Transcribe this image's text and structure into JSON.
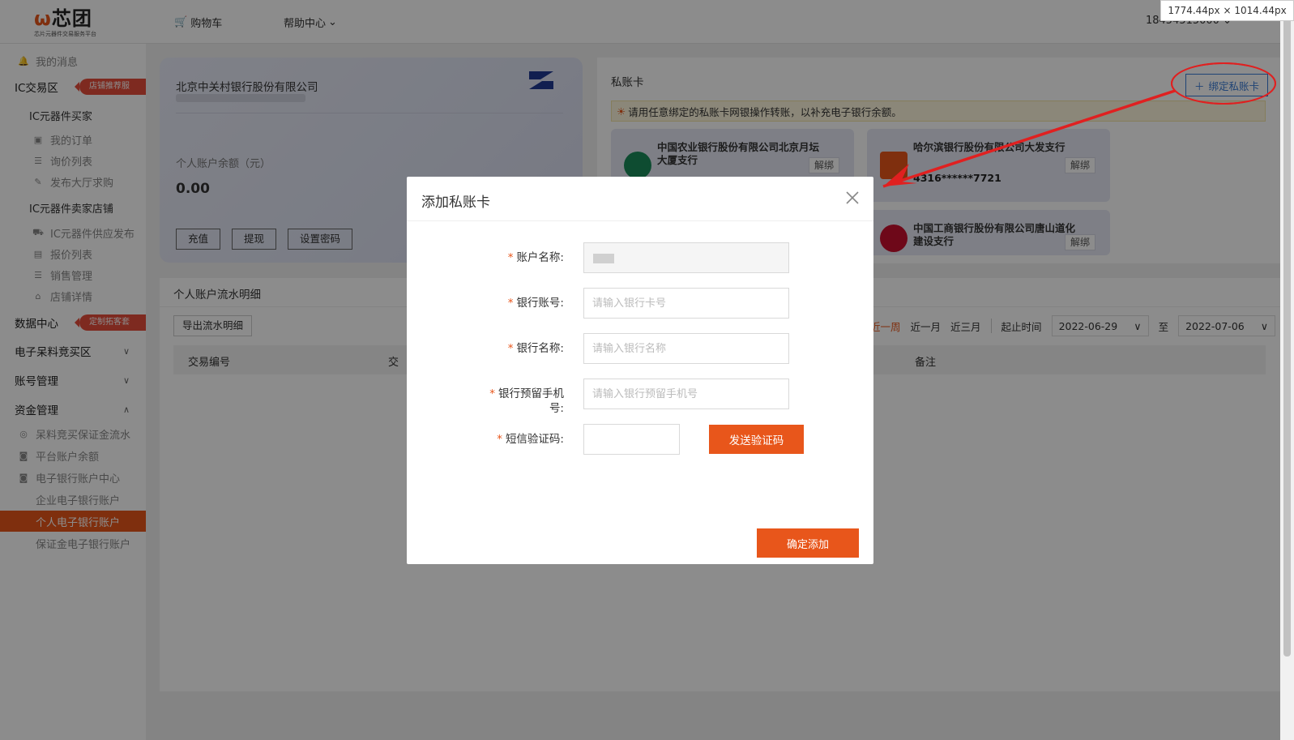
{
  "size_badge": "1774.44px × 1014.44px",
  "header": {
    "logo_text": "芯团",
    "logo_sub": "芯片元器件交易服务平台",
    "cart": "购物车",
    "help": "帮助中心",
    "user": "18454515000"
  },
  "sidebar": {
    "messages": "我的消息",
    "ic_zone": "IC交易区",
    "ic_zone_tag": "店铺推荐服务",
    "buyer": "IC元器件买家",
    "my_orders": "我的订单",
    "inquiry_list": "询价列表",
    "publish_purchase": "发布大厅求购",
    "seller_store": "IC元器件卖家店铺",
    "supply_publish": "IC元器件供应发布",
    "quote_list": "报价列表",
    "sales_mgmt": "销售管理",
    "store_detail": "店铺详情",
    "data_center": "数据中心",
    "data_center_tag": "定制拓客套餐",
    "e_bidding": "电子呆料竞买区",
    "account_mgmt": "账号管理",
    "fund_mgmt": "资金管理",
    "deposit_flow": "呆料竞买保证金流水",
    "platform_balance": "平台账户余额",
    "ebank_center": "电子银行账户中心",
    "corp_ebank": "企业电子银行账户",
    "personal_ebank": "个人电子银行账户",
    "deposit_ebank": "保证金电子银行账户"
  },
  "account_card": {
    "bank": "北京中关村银行股份有限公司",
    "balance_label": "个人账户余额（元）",
    "balance": "0.00",
    "recharge": "充值",
    "withdraw": "提现",
    "set_password": "设置密码"
  },
  "private_cards": {
    "title": "私账卡",
    "bind_button": "绑定私账卡",
    "notice": "请用任意绑定的私账卡网银操作转账，以补充电子银行余额。",
    "cards": [
      {
        "name": "中国农业银行股份有限公司北京月坛大厦支行",
        "number": "",
        "unbind": "解绑",
        "color": "#1a8a5a"
      },
      {
        "name": "哈尔滨银行股份有限公司大发支行",
        "number": "4316******7721",
        "unbind": "解绑",
        "color": "#e8561b"
      },
      {
        "name": "中国工商银行股份有限公司唐山道化建设支行",
        "number": "",
        "unbind": "解绑",
        "color": "#c8102e"
      }
    ]
  },
  "detail": {
    "title": "个人账户流水明细",
    "export": "导出流水明细",
    "filters": {
      "week": "近一周",
      "month": "近一月",
      "three_months": "近三月",
      "start_label": "起止时间",
      "start": "2022-06-29",
      "to": "至",
      "end": "2022-07-06"
    },
    "columns": {
      "trade_no": "交易编号",
      "trade_time": "交",
      "remark": "备注"
    }
  },
  "modal": {
    "title": "添加私账卡",
    "fields": {
      "account_name": {
        "label": "账户名称:",
        "value": ""
      },
      "bank_account": {
        "label": "银行账号:",
        "placeholder": "请输入银行卡号"
      },
      "bank_name": {
        "label": "银行名称:",
        "placeholder": "请输入银行名称"
      },
      "bank_phone": {
        "label": "银行预留手机号:",
        "placeholder": "请输入银行预留手机号"
      },
      "sms_code": {
        "label": "短信验证码:",
        "value": ""
      }
    },
    "send_code": "发送验证码",
    "confirm": "确定添加"
  },
  "colors": {
    "accent": "#e8561b",
    "link_blue": "#3a7bd5",
    "annotation_red": "#e02020"
  }
}
